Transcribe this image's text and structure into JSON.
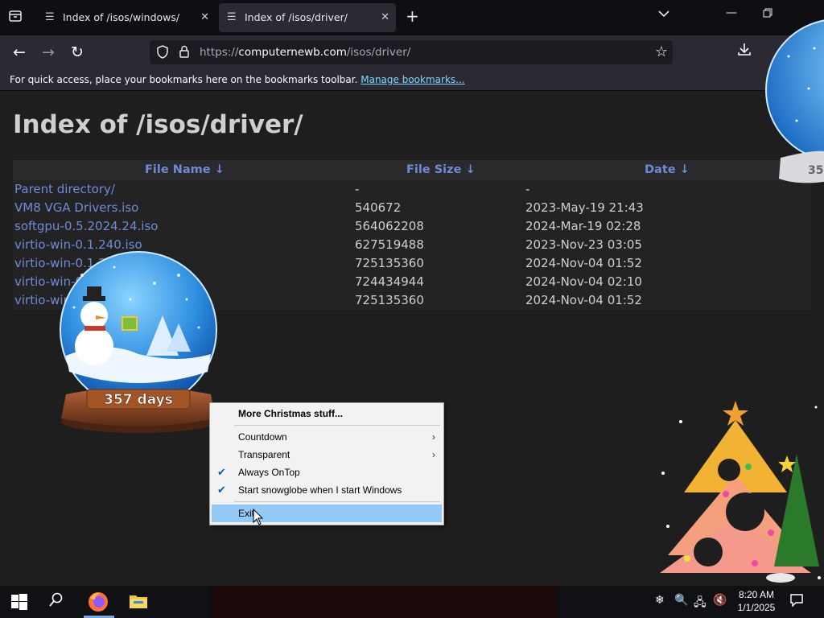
{
  "browser": {
    "tabs": [
      {
        "title": "Index of /isos/windows/",
        "active": false
      },
      {
        "title": "Index of /isos/driver/",
        "active": true
      }
    ],
    "url_prefix": "https://",
    "url_domain": "computernewb.com",
    "url_path": "/isos/driver/",
    "bookmarks_bar_text": "For quick access, place your bookmarks here on the bookmarks toolbar.",
    "bookmarks_bar_link": "Manage bookmarks..."
  },
  "page": {
    "title": "Index of /isos/driver/",
    "columns": [
      "File Name  ↓",
      "File Size  ↓",
      "Date  ↓"
    ],
    "rows": [
      {
        "name": "Parent directory/",
        "size": "-",
        "date": "-"
      },
      {
        "name": "VM8 VGA Drivers.iso",
        "size": "540672",
        "date": "2023-May-19 21:43"
      },
      {
        "name": "softgpu-0.5.2024.24.iso",
        "size": "564062208",
        "date": "2024-Mar-19 02:28"
      },
      {
        "name": "virtio-win-0.1.240.iso",
        "size": "627519488",
        "date": "2023-Nov-23 03:05"
      },
      {
        "name": "virtio-win-0.1.2",
        "size": "725135360",
        "date": "2024-Nov-04 01:52"
      },
      {
        "name": "virtio-win-0",
        "size": "724434944",
        "date": "2024-Nov-04 02:10"
      },
      {
        "name": "virtio-win",
        "size": "725135360",
        "date": "2024-Nov-04 01:52"
      }
    ]
  },
  "snowglobe": {
    "badge": "357 days",
    "badge_small": "35"
  },
  "context_menu": {
    "items": [
      {
        "label": "More Christmas stuff...",
        "bold": true
      },
      {
        "label": "Countdown",
        "submenu": true
      },
      {
        "label": "Transparent",
        "submenu": true
      },
      {
        "label": "Always OnTop",
        "checked": true
      },
      {
        "label": "Start snowglobe when I start Windows",
        "checked": true
      },
      {
        "label": "Exit",
        "highlighted": true
      }
    ]
  },
  "taskbar": {
    "time": "8:20 AM",
    "date": "1/1/2025"
  },
  "colors": {
    "link": "#6f8ad6",
    "menu_highlight": "#91c9f7",
    "tab_active": "#2b2a33"
  }
}
